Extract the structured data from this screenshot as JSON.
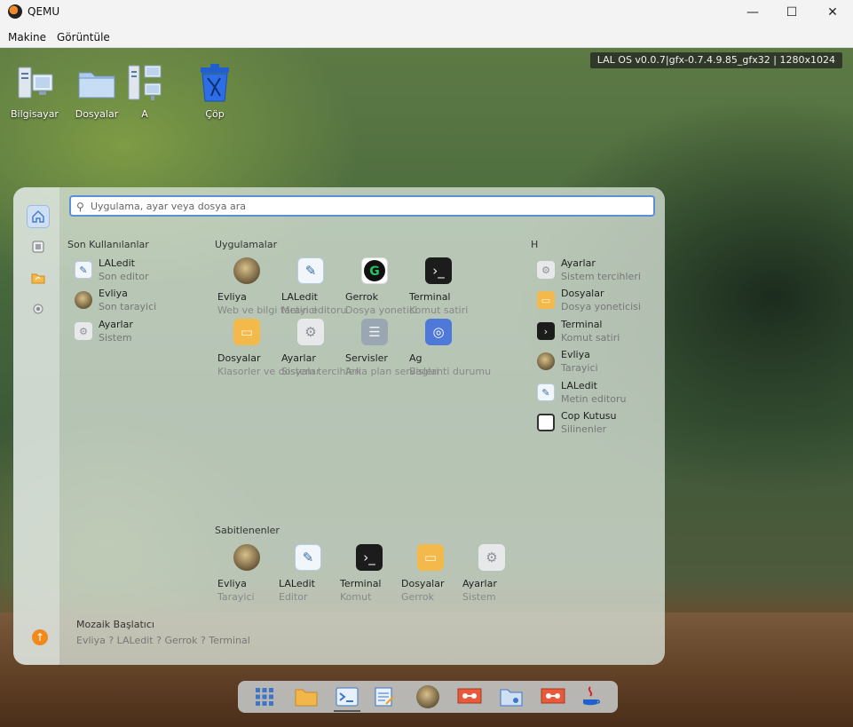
{
  "window": {
    "title": "QEMU",
    "minimize_glyph": "—",
    "maximize_glyph": "☐",
    "close_glyph": "✕"
  },
  "menu": {
    "items": [
      "Makine",
      "Görüntüle"
    ]
  },
  "vm": {
    "version_label": "LAL OS v0.0.7|gfx-0.7.4.9.85_gfx32 | 1280x1024",
    "desktop_icons": [
      {
        "label": "Bilgisayar",
        "icon": "computer-icon"
      },
      {
        "label": "Dosyalar",
        "icon": "folder-icon"
      },
      {
        "label": "A",
        "icon": "network-computers-icon"
      },
      {
        "label": "Çöp",
        "icon": "trash-icon"
      }
    ],
    "launcher": {
      "search_placeholder": "Uygulama, ayar veya dosya ara",
      "recent_title": "Son Kullanılanlar",
      "recent": [
        {
          "title": "LALedit",
          "subtitle": "Son editor",
          "icon": "editor-icon"
        },
        {
          "title": "Evliya",
          "subtitle": "Son tarayici",
          "icon": "avatar-icon"
        },
        {
          "title": "Ayarlar",
          "subtitle": "Sistem",
          "icon": "settings-icon"
        }
      ],
      "apps_title": "Uygulamalar",
      "apps": [
        {
          "title": "Evliya",
          "subtitle": "Web ve bilgi tarayici",
          "icon": "avatar-icon"
        },
        {
          "title": "LALedit",
          "subtitle": "Metin editoru",
          "icon": "editor-icon"
        },
        {
          "title": "Gerrok",
          "subtitle": "Dosya yonetici",
          "icon": "gerrok-icon"
        },
        {
          "title": "Terminal",
          "subtitle": "Komut satiri",
          "icon": "terminal-icon"
        },
        {
          "title": "Dosyalar",
          "subtitle": "Klasorler ve dosyalar",
          "icon": "folder-icon"
        },
        {
          "title": "Ayarlar",
          "subtitle": "Sistem tercihleri",
          "icon": "settings-icon"
        },
        {
          "title": "Servisler",
          "subtitle": "Arka plan servisleri",
          "icon": "services-icon"
        },
        {
          "title": "Ag",
          "subtitle": "Baglanti durumu",
          "icon": "network-icon"
        }
      ],
      "side_title": "H",
      "side": [
        {
          "title": "Ayarlar",
          "subtitle": "Sistem tercihleri",
          "icon": "settings-icon"
        },
        {
          "title": "Dosyalar",
          "subtitle": "Dosya yoneticisi",
          "icon": "folder-icon"
        },
        {
          "title": "Terminal",
          "subtitle": "Komut satiri",
          "icon": "terminal-icon"
        },
        {
          "title": "Evliya",
          "subtitle": "Tarayici",
          "icon": "avatar-icon"
        },
        {
          "title": "LALedit",
          "subtitle": "Metin editoru",
          "icon": "editor-icon"
        },
        {
          "title": "Cop Kutusu",
          "subtitle": "Silinenler",
          "icon": "trash-icon"
        }
      ],
      "pinned_title": "Sabitlenenler",
      "pinned": [
        {
          "title": "Evliya",
          "subtitle": "Tarayici",
          "icon": "avatar-icon"
        },
        {
          "title": "LALedit",
          "subtitle": "Editor",
          "icon": "editor-icon"
        },
        {
          "title": "Terminal",
          "subtitle": "Komut",
          "icon": "terminal-icon"
        },
        {
          "title": "Dosyalar",
          "subtitle": "Gerrok",
          "icon": "folder-icon"
        },
        {
          "title": "Ayarlar",
          "subtitle": "Sistem",
          "icon": "settings-icon"
        }
      ],
      "footer_title": "Mozaik Başlatıcı",
      "footer_list": "Evliya  ?  LALedit  ?  Gerrok  ?  Terminal"
    },
    "taskbar": [
      "app-grid-icon",
      "folder-icon",
      "terminal-icon",
      "editor-icon",
      "avatar-icon",
      "remote-desktop-icon",
      "file-share-icon",
      "remote-desktop-icon",
      "java-icon"
    ]
  }
}
